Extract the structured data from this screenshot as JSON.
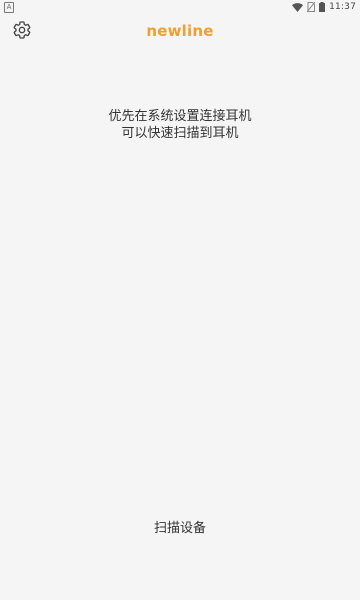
{
  "status_bar": {
    "left_indicator": "A",
    "time": "11:37",
    "icons": [
      "wifi-icon",
      "sim-off-icon",
      "battery-icon"
    ]
  },
  "header": {
    "brand": "newline",
    "brand_color": "#f0a030",
    "settings_icon": "gear-icon"
  },
  "main": {
    "message_line1": "优先在系统设置连接耳机",
    "message_line2": "可以快速扫描到耳机"
  },
  "footer": {
    "scan_label": "扫描设备"
  }
}
